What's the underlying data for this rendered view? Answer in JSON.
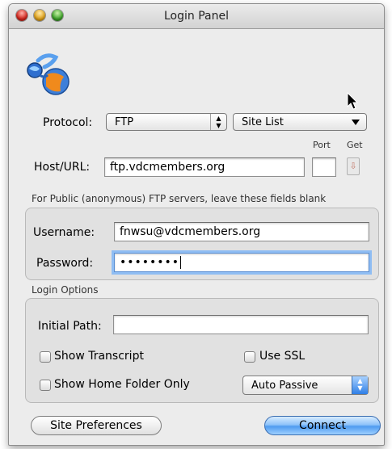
{
  "window": {
    "title": "Login Panel"
  },
  "protocol": {
    "label": "Protocol:",
    "value": "FTP"
  },
  "site_list": {
    "value": "Site List"
  },
  "host": {
    "label": "Host/URL:",
    "value": "ftp.vdcmembers.org",
    "port_label": "Port",
    "port_value": "",
    "get_label": "Get"
  },
  "notice": "For Public (anonymous) FTP servers, leave these fields blank",
  "username": {
    "label": "Username:",
    "value": "fnwsu@vdcmembers.org"
  },
  "password": {
    "label": "Password:",
    "masked_value": "••••••••"
  },
  "login_options": {
    "heading": "Login Options",
    "initial_path_label": "Initial Path:",
    "initial_path_value": "",
    "show_transcript": "Show Transcript",
    "use_ssl": "Use SSL",
    "show_home_folder_only": "Show Home Folder Only",
    "passive_mode": "Auto Passive"
  },
  "buttons": {
    "site_preferences": "Site Preferences",
    "connect": "Connect"
  },
  "icons": {
    "app_logo": "globe-network-icon",
    "cursor": "arrow-cursor-icon"
  },
  "colors": {
    "accent_blue": "#4f9bf0",
    "close": "#d3261d",
    "minimize": "#e0a21b",
    "zoom": "#3ea42a"
  }
}
